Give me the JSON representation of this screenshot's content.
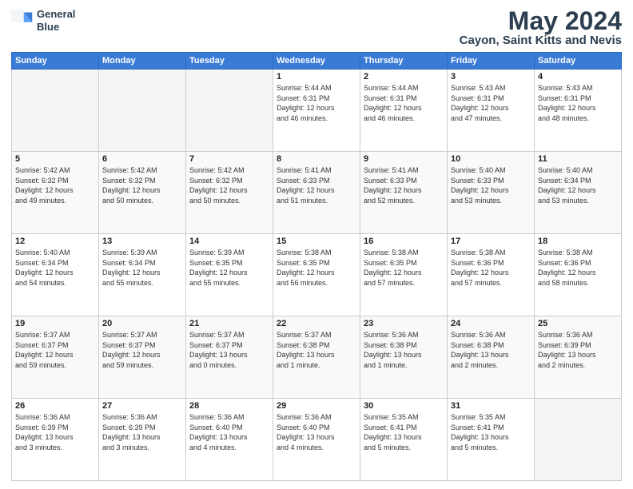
{
  "logo": {
    "line1": "General",
    "line2": "Blue"
  },
  "title": "May 2024",
  "subtitle": "Cayon, Saint Kitts and Nevis",
  "days_of_week": [
    "Sunday",
    "Monday",
    "Tuesday",
    "Wednesday",
    "Thursday",
    "Friday",
    "Saturday"
  ],
  "weeks": [
    [
      {
        "day": "",
        "info": ""
      },
      {
        "day": "",
        "info": ""
      },
      {
        "day": "",
        "info": ""
      },
      {
        "day": "1",
        "info": "Sunrise: 5:44 AM\nSunset: 6:31 PM\nDaylight: 12 hours\nand 46 minutes."
      },
      {
        "day": "2",
        "info": "Sunrise: 5:44 AM\nSunset: 6:31 PM\nDaylight: 12 hours\nand 46 minutes."
      },
      {
        "day": "3",
        "info": "Sunrise: 5:43 AM\nSunset: 6:31 PM\nDaylight: 12 hours\nand 47 minutes."
      },
      {
        "day": "4",
        "info": "Sunrise: 5:43 AM\nSunset: 6:31 PM\nDaylight: 12 hours\nand 48 minutes."
      }
    ],
    [
      {
        "day": "5",
        "info": "Sunrise: 5:42 AM\nSunset: 6:32 PM\nDaylight: 12 hours\nand 49 minutes."
      },
      {
        "day": "6",
        "info": "Sunrise: 5:42 AM\nSunset: 6:32 PM\nDaylight: 12 hours\nand 50 minutes."
      },
      {
        "day": "7",
        "info": "Sunrise: 5:42 AM\nSunset: 6:32 PM\nDaylight: 12 hours\nand 50 minutes."
      },
      {
        "day": "8",
        "info": "Sunrise: 5:41 AM\nSunset: 6:33 PM\nDaylight: 12 hours\nand 51 minutes."
      },
      {
        "day": "9",
        "info": "Sunrise: 5:41 AM\nSunset: 6:33 PM\nDaylight: 12 hours\nand 52 minutes."
      },
      {
        "day": "10",
        "info": "Sunrise: 5:40 AM\nSunset: 6:33 PM\nDaylight: 12 hours\nand 53 minutes."
      },
      {
        "day": "11",
        "info": "Sunrise: 5:40 AM\nSunset: 6:34 PM\nDaylight: 12 hours\nand 53 minutes."
      }
    ],
    [
      {
        "day": "12",
        "info": "Sunrise: 5:40 AM\nSunset: 6:34 PM\nDaylight: 12 hours\nand 54 minutes."
      },
      {
        "day": "13",
        "info": "Sunrise: 5:39 AM\nSunset: 6:34 PM\nDaylight: 12 hours\nand 55 minutes."
      },
      {
        "day": "14",
        "info": "Sunrise: 5:39 AM\nSunset: 6:35 PM\nDaylight: 12 hours\nand 55 minutes."
      },
      {
        "day": "15",
        "info": "Sunrise: 5:38 AM\nSunset: 6:35 PM\nDaylight: 12 hours\nand 56 minutes."
      },
      {
        "day": "16",
        "info": "Sunrise: 5:38 AM\nSunset: 6:35 PM\nDaylight: 12 hours\nand 57 minutes."
      },
      {
        "day": "17",
        "info": "Sunrise: 5:38 AM\nSunset: 6:36 PM\nDaylight: 12 hours\nand 57 minutes."
      },
      {
        "day": "18",
        "info": "Sunrise: 5:38 AM\nSunset: 6:36 PM\nDaylight: 12 hours\nand 58 minutes."
      }
    ],
    [
      {
        "day": "19",
        "info": "Sunrise: 5:37 AM\nSunset: 6:37 PM\nDaylight: 12 hours\nand 59 minutes."
      },
      {
        "day": "20",
        "info": "Sunrise: 5:37 AM\nSunset: 6:37 PM\nDaylight: 12 hours\nand 59 minutes."
      },
      {
        "day": "21",
        "info": "Sunrise: 5:37 AM\nSunset: 6:37 PM\nDaylight: 13 hours\nand 0 minutes."
      },
      {
        "day": "22",
        "info": "Sunrise: 5:37 AM\nSunset: 6:38 PM\nDaylight: 13 hours\nand 1 minute."
      },
      {
        "day": "23",
        "info": "Sunrise: 5:36 AM\nSunset: 6:38 PM\nDaylight: 13 hours\nand 1 minute."
      },
      {
        "day": "24",
        "info": "Sunrise: 5:36 AM\nSunset: 6:38 PM\nDaylight: 13 hours\nand 2 minutes."
      },
      {
        "day": "25",
        "info": "Sunrise: 5:36 AM\nSunset: 6:39 PM\nDaylight: 13 hours\nand 2 minutes."
      }
    ],
    [
      {
        "day": "26",
        "info": "Sunrise: 5:36 AM\nSunset: 6:39 PM\nDaylight: 13 hours\nand 3 minutes."
      },
      {
        "day": "27",
        "info": "Sunrise: 5:36 AM\nSunset: 6:39 PM\nDaylight: 13 hours\nand 3 minutes."
      },
      {
        "day": "28",
        "info": "Sunrise: 5:36 AM\nSunset: 6:40 PM\nDaylight: 13 hours\nand 4 minutes."
      },
      {
        "day": "29",
        "info": "Sunrise: 5:36 AM\nSunset: 6:40 PM\nDaylight: 13 hours\nand 4 minutes."
      },
      {
        "day": "30",
        "info": "Sunrise: 5:35 AM\nSunset: 6:41 PM\nDaylight: 13 hours\nand 5 minutes."
      },
      {
        "day": "31",
        "info": "Sunrise: 5:35 AM\nSunset: 6:41 PM\nDaylight: 13 hours\nand 5 minutes."
      },
      {
        "day": "",
        "info": ""
      }
    ]
  ]
}
